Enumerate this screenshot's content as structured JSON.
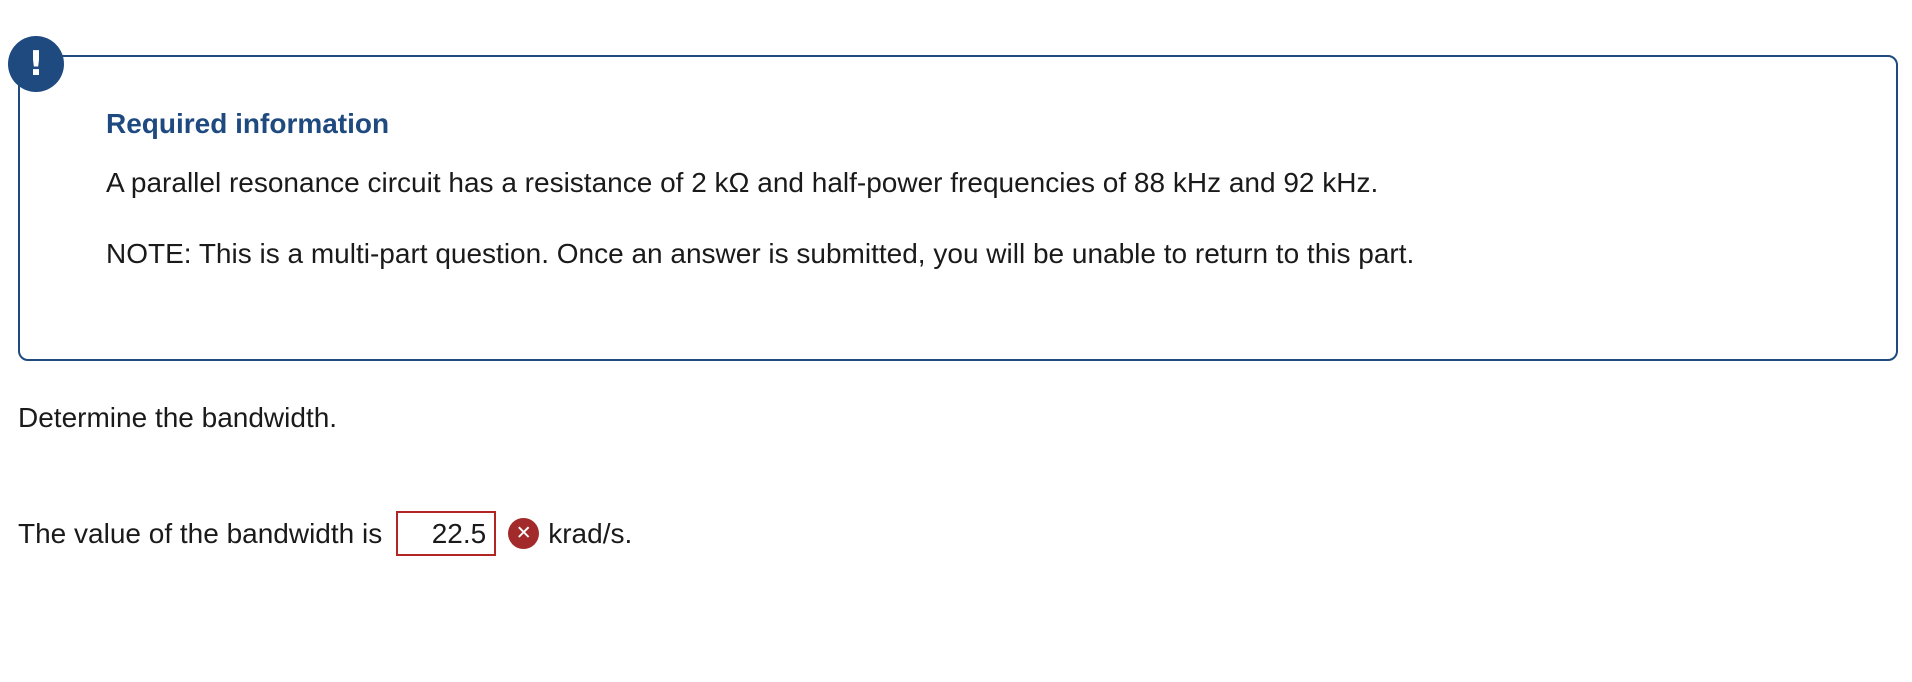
{
  "info_box": {
    "badge_icon": "exclamation-icon",
    "badge_glyph": "!",
    "title": "Required information",
    "paragraph_1": "A parallel resonance circuit has a resistance of 2 kΩ and half-power frequencies of 88 kHz and 92 kHz.",
    "paragraph_2": "NOTE: This is a multi-part question. Once an answer is submitted, you will be unable to return to this part."
  },
  "question": {
    "prompt": "Determine the bandwidth.",
    "answer_prefix": "The value of the bandwidth is",
    "answer_value": "22.5",
    "answer_status_icon": "incorrect-x-icon",
    "answer_status_glyph": "✕",
    "answer_unit": "krad/s."
  },
  "colors": {
    "accent_blue": "#1f4a80",
    "error_red": "#a32a2a",
    "text": "#1a1a1a"
  }
}
